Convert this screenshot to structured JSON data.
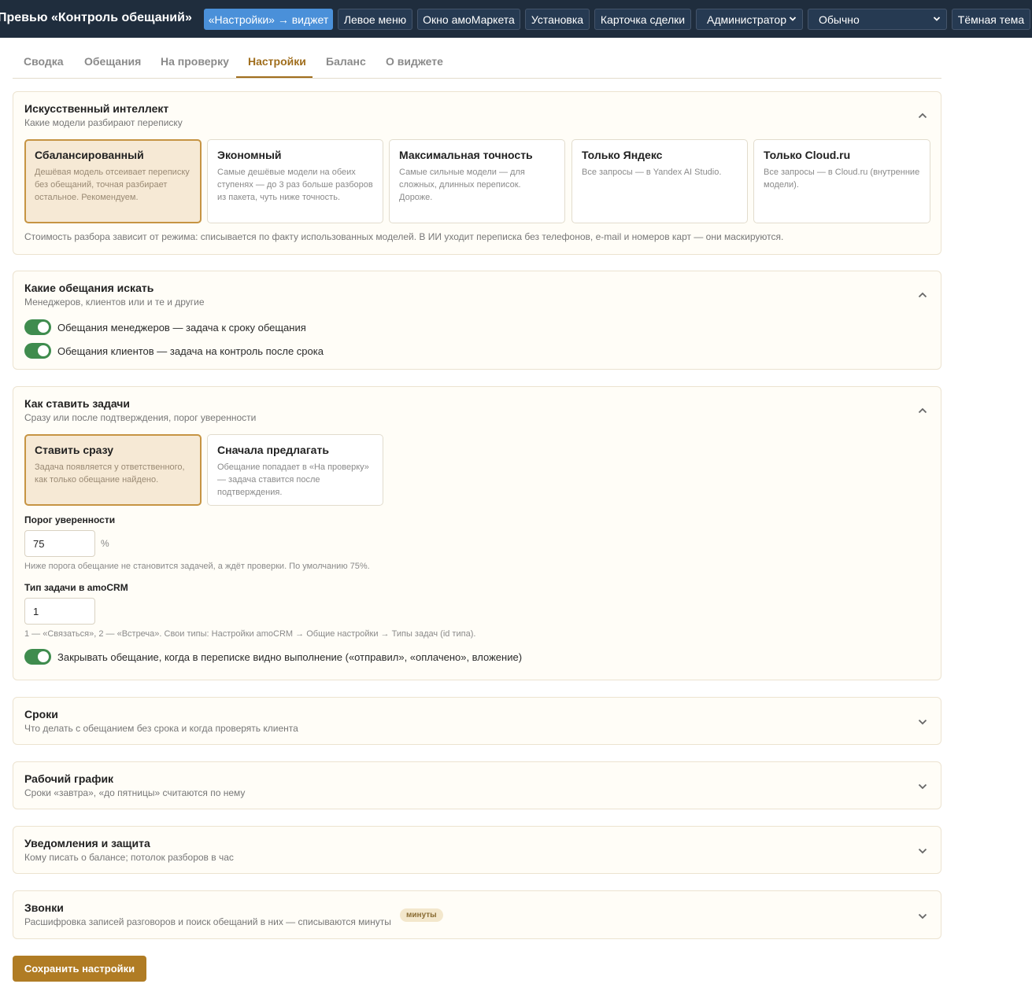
{
  "topbar": {
    "title": "Превью «Контроль обещаний»",
    "buttons": [
      "«Настройки» → виджет",
      "Левое меню",
      "Окно амоМаркета",
      "Установка",
      "Карточка сделки"
    ],
    "role_select": "Администратор",
    "mode_select": "Обычно",
    "theme_button": "Тёмная тема"
  },
  "tabs": [
    "Сводка",
    "Обещания",
    "На проверку",
    "Настройки",
    "Баланс",
    "О виджете"
  ],
  "active_tab": "Настройки",
  "ai": {
    "title": "Искусственный интеллект",
    "subtitle": "Какие модели разбирают переписку",
    "options": [
      {
        "title": "Сбалансированный",
        "desc": "Дешёвая модель отсеивает переписку без обещаний, точная разбирает остальное. Рекомендуем."
      },
      {
        "title": "Экономный",
        "desc": "Самые дешёвые модели на обеих ступенях — до 3 раз больше разборов из пакета, чуть ниже точность."
      },
      {
        "title": "Максимальная точность",
        "desc": "Самые сильные модели — для сложных, длинных переписок. Дороже."
      },
      {
        "title": "Только Яндекс",
        "desc": "Все запросы — в Yandex AI Studio."
      },
      {
        "title": "Только Cloud.ru",
        "desc": "Все запросы — в Cloud.ru (внутренние модели)."
      }
    ],
    "selected": "Сбалансированный",
    "note": "Стоимость разбора зависит от режима: списывается по факту использованных моделей. В ИИ уходит переписка без телефонов, e-mail и номеров карт — они маскируются."
  },
  "promises": {
    "title": "Какие обещания искать",
    "subtitle": "Менеджеров, клиентов или и те и другие",
    "toggles": [
      {
        "label": "Обещания менеджеров — задача к сроку обещания",
        "on": true
      },
      {
        "label": "Обещания клиентов — задача на контроль после срока",
        "on": true
      }
    ]
  },
  "tasks": {
    "title": "Как ставить задачи",
    "subtitle": "Сразу или после подтверждения, порог уверенности",
    "options": [
      {
        "title": "Ставить сразу",
        "desc": "Задача появляется у ответственного, как только обещание найдено."
      },
      {
        "title": "Сначала предлагать",
        "desc": "Обещание попадает в «На проверку» — задача ставится после подтверждения."
      }
    ],
    "selected": "Ставить сразу",
    "threshold_label": "Порог уверенности",
    "threshold_value": "75",
    "threshold_unit": "%",
    "threshold_note": "Ниже порога обещание не становится задачей, а ждёт проверки. По умолчанию 75%.",
    "type_label": "Тип задачи в amoCRM",
    "type_value": "1",
    "type_note": "1 — «Связаться», 2 — «Встреча». Свои типы: Настройки amoCRM → Общие настройки → Типы задач (id типа).",
    "close_toggle": {
      "label": "Закрывать обещание, когда в переписке видно выполнение («отправил», «оплачено», вложение)",
      "on": true
    }
  },
  "collapsed": [
    {
      "title": "Сроки",
      "subtitle": "Что делать с обещанием без срока и когда проверять клиента"
    },
    {
      "title": "Рабочий график",
      "subtitle": "Сроки «завтра», «до пятницы» считаются по нему"
    },
    {
      "title": "Уведомления и защита",
      "subtitle": "Кому писать о балансе; потолок разборов в час"
    },
    {
      "title": "Звонки",
      "subtitle": "Расшифровка записей разговоров и поиск обещаний в них — списываются минуты",
      "badge": "минуты"
    }
  ],
  "save_label": "Сохранить настройки",
  "colors": {
    "accent": "#b07c24",
    "toggle_on": "#3f8c4e",
    "topbar": "#1f2d3d",
    "active_top_button": "#4a90d9"
  }
}
